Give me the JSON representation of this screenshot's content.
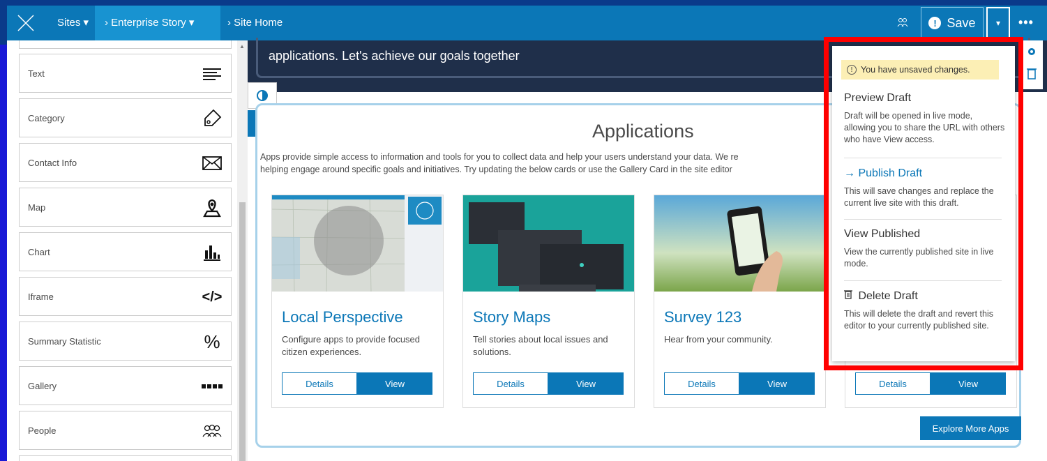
{
  "topbar": {
    "sites_label": "Sites ▾",
    "story_label": "› Enterprise Story ▾",
    "home_label": "› Site Home",
    "save_label": "Save",
    "save_warn": "!",
    "caret": "▾",
    "more": "•••",
    "people_icon": "ꭥ"
  },
  "sidebar": {
    "items": [
      {
        "label": "Text",
        "icon": "text-lines-icon"
      },
      {
        "label": "Category",
        "icon": "tag-icon"
      },
      {
        "label": "Contact Info",
        "icon": "envelope-icon"
      },
      {
        "label": "Map",
        "icon": "map-pin-icon"
      },
      {
        "label": "Chart",
        "icon": "bar-chart-icon"
      },
      {
        "label": "Iframe",
        "icon": "code-icon"
      },
      {
        "label": "Summary Statistic",
        "icon": "percent-icon"
      },
      {
        "label": "Gallery",
        "icon": "gallery-icon"
      },
      {
        "label": "People",
        "icon": "people-icon"
      }
    ],
    "icon_glyphs": {
      "code": "</>",
      "percent": "%"
    }
  },
  "hero": {
    "text": "applications. Let's achieve our goals together"
  },
  "apps": {
    "title": "Applications",
    "description": "Apps provide simple access to information and tools for you to collect data and help your users understand your data. We re",
    "description2": "helping engage around specific goals and initiatives. Try updating the below cards or use the Gallery Card in the site editor",
    "cards": [
      {
        "title": "Local Perspective",
        "desc": "Configure apps to provide focused citizen experiences.",
        "details": "Details",
        "view": "View"
      },
      {
        "title": "Story Maps",
        "desc": "Tell stories about local issues and solutions.",
        "details": "Details",
        "view": "View"
      },
      {
        "title": "Survey 123",
        "desc": "Hear from your community.",
        "details": "Details",
        "view": "View"
      },
      {
        "title": "",
        "desc": "",
        "details": "Details",
        "view": "View"
      }
    ],
    "explore": "Explore More Apps"
  },
  "dropdown": {
    "unsaved": "You have unsaved changes.",
    "preview_title": "Preview Draft",
    "preview_text": "Draft will be opened in live mode, allowing you to share the URL with others who have View access.",
    "publish_title": "Publish Draft",
    "publish_text": "This will save changes and replace the current live site with this draft.",
    "published_title": "View Published",
    "published_text": "View the currently published site in live mode.",
    "delete_title": "Delete Draft",
    "delete_text": "This will delete the draft and revert this editor to your currently published site."
  },
  "colors": {
    "brand": "#0b77b7",
    "highlight": "#ff0000",
    "warning_bg": "#fcefb5"
  }
}
